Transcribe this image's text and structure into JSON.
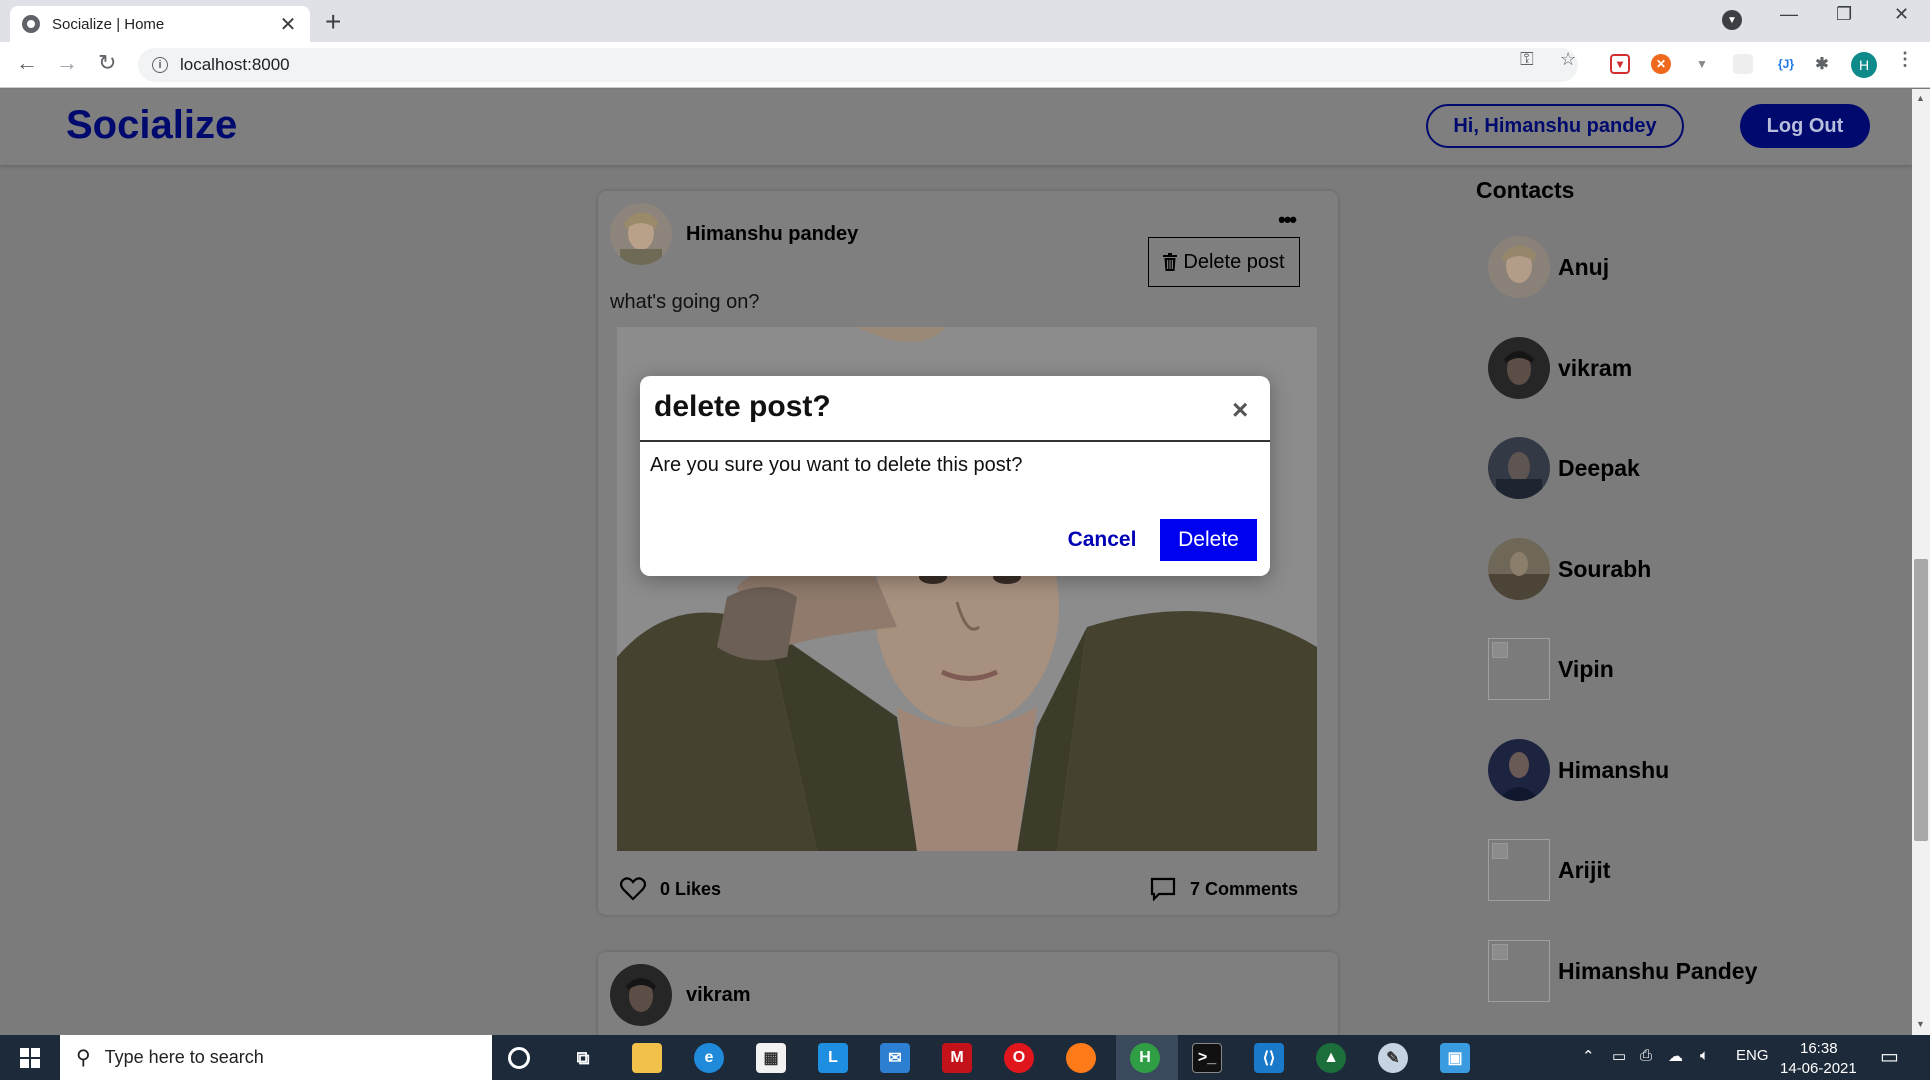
{
  "browser": {
    "tab_title": "Socialize | Home",
    "tab_close": "✕",
    "new_tab": "+",
    "url": "localhost:8000",
    "profile_initial": "H",
    "extension_json_label": "{J}"
  },
  "site": {
    "logo": "Socialize",
    "greeting": "Hi, Himanshu pandey",
    "logout_label": "Log Out"
  },
  "post": {
    "author": "Himanshu pandey",
    "more_dots": "•••",
    "delete_post_label": "Delete post",
    "text": "what's going on?",
    "likes": "0 Likes",
    "comments": "7 Comments"
  },
  "next_post": {
    "author": "vikram"
  },
  "contacts": {
    "title": "Contacts",
    "items": [
      {
        "name": "Anuj",
        "has_image": true,
        "avatar_color": "#a08a78"
      },
      {
        "name": "vikram",
        "has_image": true,
        "avatar_color": "#2b2b2b"
      },
      {
        "name": "Deepak",
        "has_image": true,
        "avatar_color": "#3a3f4a"
      },
      {
        "name": "Sourabh",
        "has_image": true,
        "avatar_color": "#6d6452"
      },
      {
        "name": "Vipin",
        "has_image": false
      },
      {
        "name": "Himanshu",
        "has_image": true,
        "avatar_color": "#1f2a48"
      },
      {
        "name": "Arijit",
        "has_image": false
      },
      {
        "name": "Himanshu Pandey",
        "has_image": false
      }
    ]
  },
  "modal": {
    "title": "delete post?",
    "close_symbol": "×",
    "body": "Are you sure you want to delete this post?",
    "cancel_label": "Cancel",
    "delete_label": "Delete"
  },
  "taskbar": {
    "search_placeholder": "Type here to search",
    "language": "ENG",
    "time": "16:38",
    "date": "14-06-2021"
  },
  "colors": {
    "brand_navy": "#000a6e",
    "delete_blue": "#0000f0",
    "cancel_blue": "#0000b5",
    "overlay_gray": "#7b7b7b"
  }
}
